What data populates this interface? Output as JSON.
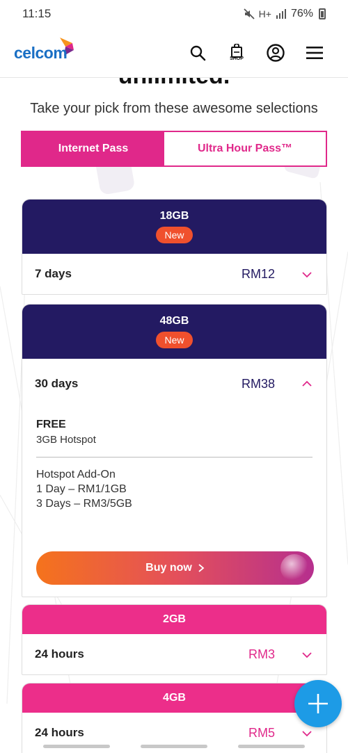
{
  "status_bar": {
    "time": "11:15",
    "signal_text": "H+",
    "battery": "76%"
  },
  "header": {
    "logo_text": "celcom",
    "shop_label": "SHOP",
    "colors": {
      "brand_blue": "#1a6fc4",
      "brand_pink": "#e0288a"
    }
  },
  "page": {
    "heading_cut": "unlimited.",
    "subtitle": "Take your pick from these awesome selections"
  },
  "tabs": [
    {
      "label": "Internet Pass",
      "active": true
    },
    {
      "label": "Ultra Hour Pass™",
      "active": false
    }
  ],
  "passes": [
    {
      "gb": "18GB",
      "badge": "New",
      "duration": "7 days",
      "price": "RM12",
      "expanded": false
    },
    {
      "gb": "48GB",
      "badge": "New",
      "duration": "30 days",
      "price": "RM38",
      "expanded": true,
      "free_title": "FREE",
      "free_text": "3GB Hotspot",
      "addon_title": "Hotspot Add-On",
      "addon_lines": [
        "1 Day – RM1/1GB",
        "3 Days – RM3/5GB"
      ],
      "cta": "Buy now"
    },
    {
      "gb": "2GB",
      "duration": "24 hours",
      "price": "RM3",
      "expanded": false
    },
    {
      "gb": "4GB",
      "duration": "24 hours",
      "price": "RM5",
      "expanded": false
    }
  ]
}
